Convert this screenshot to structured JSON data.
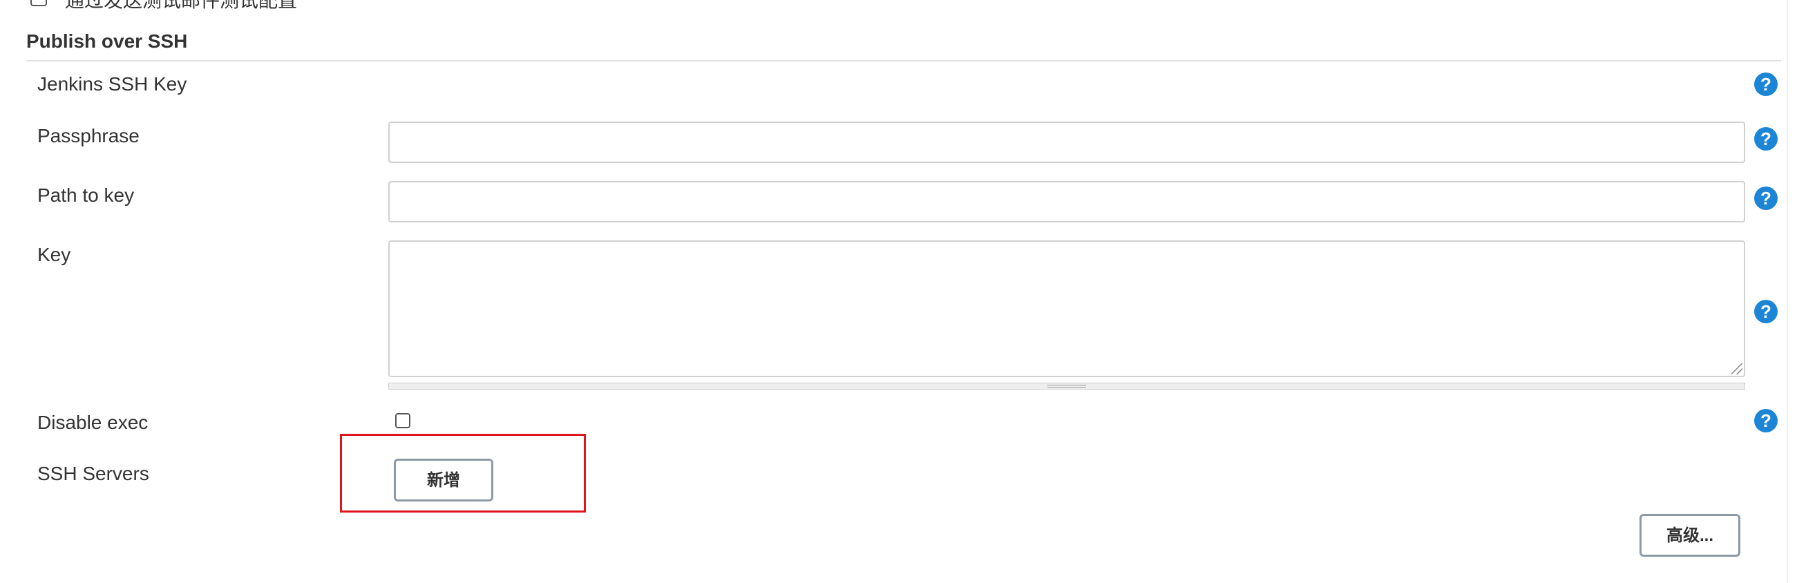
{
  "top_checkbox": {
    "label": "通过发送测试邮件测试配置",
    "checked": false
  },
  "section": {
    "title": "Publish over SSH"
  },
  "fields": {
    "jenkins_ssh_key": {
      "label": "Jenkins SSH Key"
    },
    "passphrase": {
      "label": "Passphrase",
      "value": ""
    },
    "path_to_key": {
      "label": "Path to key",
      "value": ""
    },
    "key": {
      "label": "Key",
      "value": ""
    },
    "disable_exec": {
      "label": "Disable exec",
      "checked": false
    },
    "ssh_servers": {
      "label": "SSH Servers",
      "add_button": "新增"
    }
  },
  "help": {
    "icon_glyph": "?"
  },
  "advanced_button": "高级...",
  "colors": {
    "help_blue": "#1c85d5",
    "highlight_red": "#e0141e",
    "button_border": "#8d9aa6"
  }
}
